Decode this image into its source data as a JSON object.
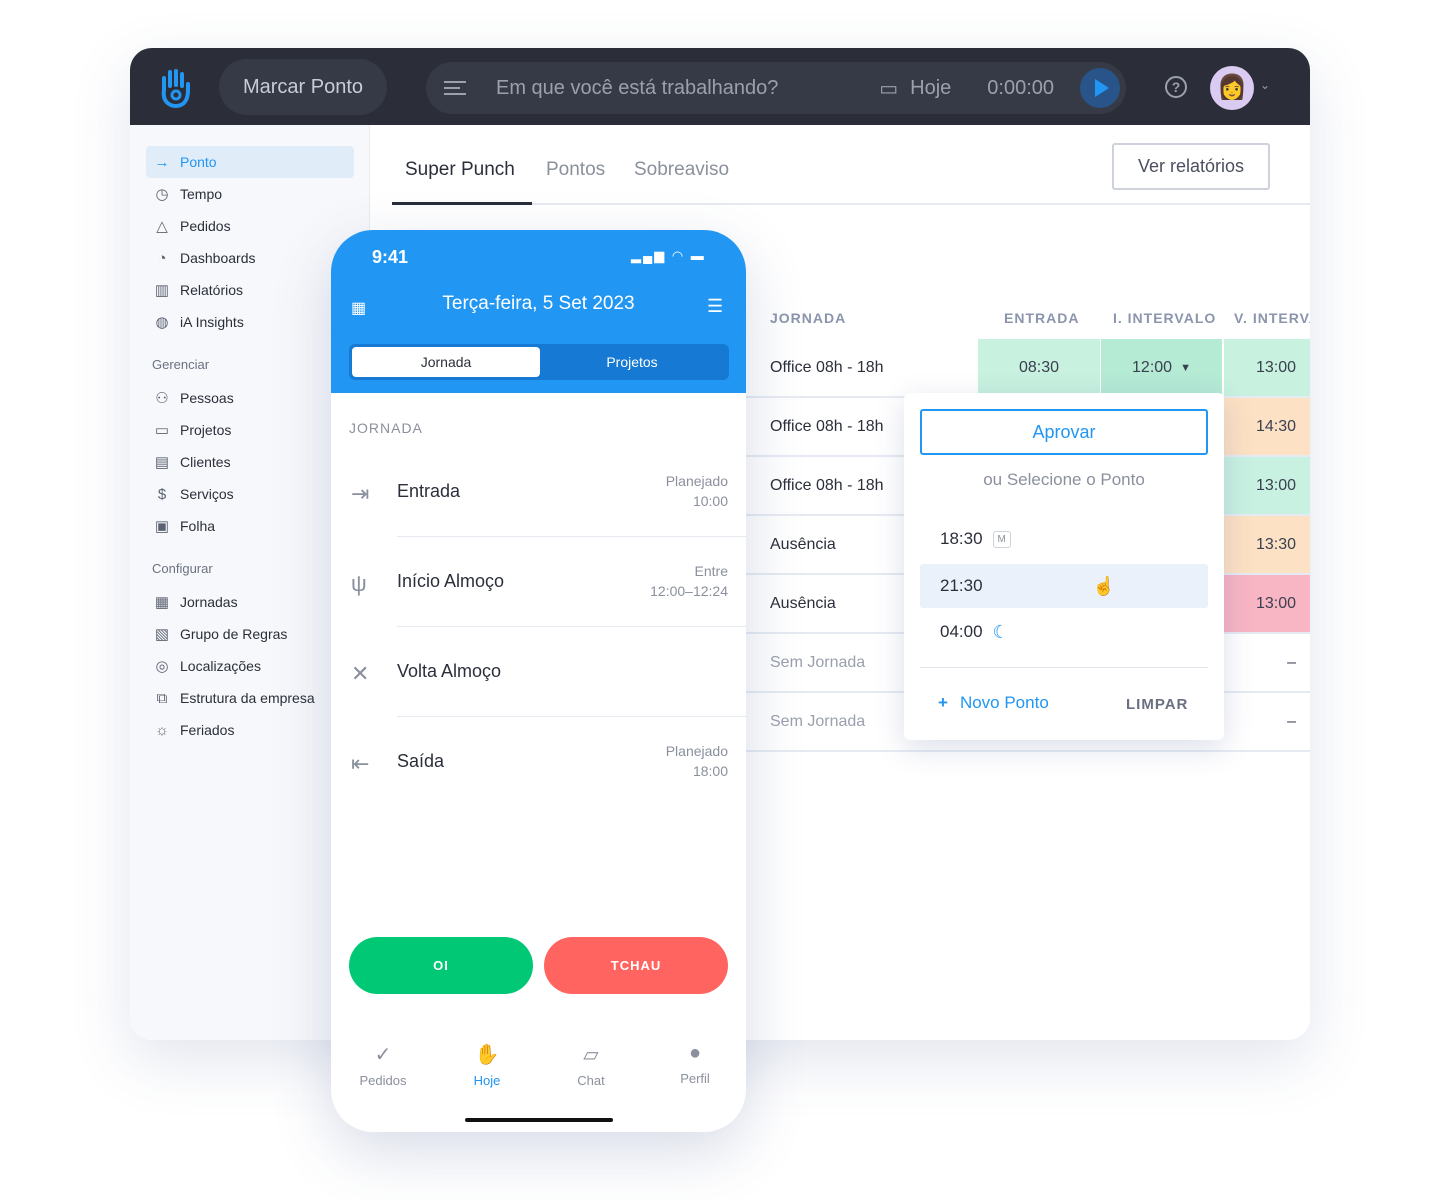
{
  "header": {
    "marcar_ponto": "Marcar Ponto",
    "search_placeholder": "Em que você está trabalhando?",
    "date": "Hoje",
    "timer": "0:00:00",
    "help": "?"
  },
  "sidebar": {
    "items": [
      {
        "label": "Ponto",
        "icon": "→",
        "active": true
      },
      {
        "label": "Tempo",
        "icon": "◷"
      },
      {
        "label": "Pedidos",
        "icon": "△"
      },
      {
        "label": "Dashboards",
        "icon": "◔"
      },
      {
        "label": "Relatórios",
        "icon": "▥"
      },
      {
        "label": "iA Insights",
        "icon": "◍"
      }
    ],
    "gerenciar_title": "Gerenciar",
    "gerenciar": [
      {
        "label": "Pessoas",
        "icon": "⚇"
      },
      {
        "label": "Projetos",
        "icon": "▭"
      },
      {
        "label": "Clientes",
        "icon": "▤"
      },
      {
        "label": "Serviços",
        "icon": "$"
      },
      {
        "label": "Folha",
        "icon": "▣"
      }
    ],
    "configurar_title": "Configurar",
    "configurar": [
      {
        "label": "Jornadas",
        "icon": "▦"
      },
      {
        "label": "Grupo de Regras",
        "icon": "▧"
      },
      {
        "label": "Localizações",
        "icon": "◎"
      },
      {
        "label": "Estrutura da empresa",
        "icon": "⧉"
      },
      {
        "label": "Feriados",
        "icon": "☼"
      }
    ]
  },
  "tabs": [
    "Super Punch",
    "Pontos",
    "Sobreaviso"
  ],
  "ver_relatorios": "Ver relatórios",
  "table": {
    "headers": [
      "JORNADA",
      "ENTRADA",
      "I. INTERVALO",
      "V. INTERVA"
    ],
    "rows": [
      {
        "jornada": "Office 08h - 18h",
        "entrada": "08:30",
        "intervalo": "12:00",
        "volta": "13:00",
        "volta_color": "#c8f1df"
      },
      {
        "jornada": "Office 08h - 18h",
        "volta": "14:30",
        "volta_color": "#fde1c4"
      },
      {
        "jornada": "Office 08h - 18h",
        "volta": "13:00",
        "volta_color": "#c9f1e2"
      },
      {
        "jornada": "Ausência",
        "volta": "13:30",
        "volta_color": "#fde1c4"
      },
      {
        "jornada": "Ausência",
        "volta": "13:00",
        "volta_color": "#f8b5c4"
      },
      {
        "jornada": "Sem Jornada",
        "volta": "–",
        "muted": true
      },
      {
        "jornada": "Sem Jornada",
        "volta": "–",
        "muted": true
      }
    ]
  },
  "popup": {
    "aprovar": "Aprovar",
    "subtitle": "ou Selecione o Ponto",
    "options": [
      {
        "time": "18:30",
        "badge": "M"
      },
      {
        "time": "21:30",
        "highlighted": true
      },
      {
        "time": "04:00",
        "icon": "moon"
      }
    ],
    "novo_ponto": "Novo Ponto",
    "limpar": "LIMPAR"
  },
  "phone": {
    "clock": "9:41",
    "date": "Terça-feira, 5 Set 2023",
    "segments": [
      "Jornada",
      "Projetos"
    ],
    "section": "JORNADA",
    "items": [
      {
        "label": "Entrada",
        "icon": "⇥",
        "right1": "Planejado",
        "right2": "10:00"
      },
      {
        "label": "Início Almoço",
        "icon": "ψ",
        "right1": "Entre",
        "right2": "12:00–12:24"
      },
      {
        "label": "Volta Almoço",
        "icon": "✕",
        "right1": "",
        "right2": ""
      },
      {
        "label": "Saída",
        "icon": "⇤",
        "right1": "Planejado",
        "right2": "18:00"
      }
    ],
    "oi": "OI",
    "tchau": "TCHAU",
    "nav": [
      {
        "label": "Pedidos",
        "icon": "✓"
      },
      {
        "label": "Hoje",
        "icon": "✋",
        "active": true
      },
      {
        "label": "Chat",
        "icon": "▱"
      },
      {
        "label": "Perfil",
        "icon": "●"
      }
    ]
  },
  "colors": {
    "accent": "#2196f3",
    "header_bg": "#2b2e38",
    "oi": "#00c875",
    "tchau": "#ff6461"
  }
}
